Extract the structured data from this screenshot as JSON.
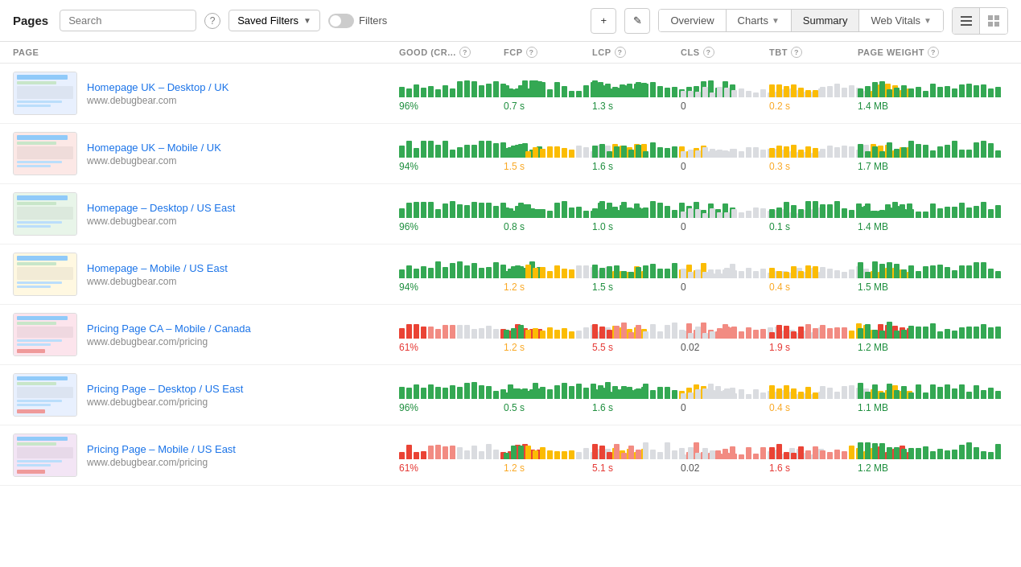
{
  "header": {
    "title": "Pages",
    "search_placeholder": "Search",
    "saved_filters_label": "Saved Filters",
    "filters_label": "Filters",
    "add_icon": "+",
    "edit_icon": "✎",
    "overview_label": "Overview",
    "charts_label": "Charts",
    "summary_label": "Summary",
    "web_vitals_label": "Web Vitals",
    "help_icon": "?"
  },
  "columns": [
    {
      "id": "page",
      "label": "PAGE",
      "has_help": false
    },
    {
      "id": "good_cr",
      "label": "GOOD (CR...",
      "has_help": true
    },
    {
      "id": "fcp",
      "label": "FCP",
      "has_help": true
    },
    {
      "id": "lcp",
      "label": "LCP",
      "has_help": true
    },
    {
      "id": "cls",
      "label": "CLS",
      "has_help": true
    },
    {
      "id": "tbt",
      "label": "TBT",
      "has_help": true
    },
    {
      "id": "page_weight",
      "label": "PAGE WEIGHT",
      "has_help": true
    }
  ],
  "rows": [
    {
      "name": "Homepage UK – Desktop / UK",
      "url": "www.debugbear.com",
      "good_cr": "96%",
      "good_cr_status": "good",
      "fcp": "0.7 s",
      "fcp_status": "good",
      "lcp": "1.3 s",
      "lcp_status": "good",
      "cls": "0",
      "cls_status": "neutral",
      "tbt": "0.2 s",
      "tbt_status": "needs-improvement",
      "page_weight": "1.4 MB",
      "page_weight_status": "good",
      "bars_good_cr": [
        6,
        8,
        7,
        8,
        9,
        7,
        8,
        9,
        8,
        7,
        9,
        10,
        8,
        9,
        10,
        9,
        8,
        9,
        8,
        10
      ],
      "bars_fcp": [
        6,
        7,
        9,
        8,
        7,
        8,
        9,
        8,
        9,
        10,
        8,
        7,
        9,
        8,
        9,
        10,
        9,
        8,
        9,
        10
      ],
      "bars_lcp": [
        6,
        8,
        7,
        9,
        8,
        9,
        8,
        7,
        9,
        10,
        8,
        9,
        8,
        9,
        10,
        9,
        8,
        9,
        8,
        10
      ],
      "bars_cls": [
        6,
        7,
        8,
        9,
        8,
        9,
        8,
        7,
        9,
        10,
        8,
        9,
        10,
        9,
        8,
        9,
        10,
        9,
        8,
        10
      ],
      "bars_tbt": [
        6,
        8,
        7,
        9,
        8,
        9,
        8,
        7,
        9,
        5,
        8,
        4,
        8,
        9,
        10,
        9,
        8,
        9,
        8,
        10
      ],
      "bars_pw": [
        6,
        8,
        7,
        9,
        8,
        9,
        8,
        7,
        9,
        10,
        8,
        9,
        10,
        9,
        8,
        9,
        10,
        9,
        8,
        10
      ]
    },
    {
      "name": "Homepage UK – Mobile / UK",
      "url": "www.debugbear.com",
      "good_cr": "94%",
      "good_cr_status": "good",
      "fcp": "1.5 s",
      "fcp_status": "needs-improvement",
      "lcp": "1.6 s",
      "lcp_status": "good",
      "cls": "0",
      "cls_status": "neutral",
      "tbt": "0.3 s",
      "tbt_status": "needs-improvement",
      "page_weight": "1.7 MB",
      "page_weight_status": "good"
    },
    {
      "name": "Homepage – Desktop / US East",
      "url": "www.debugbear.com",
      "good_cr": "96%",
      "good_cr_status": "good",
      "fcp": "0.8 s",
      "fcp_status": "good",
      "lcp": "1.0 s",
      "lcp_status": "good",
      "cls": "0",
      "cls_status": "neutral",
      "tbt": "0.1 s",
      "tbt_status": "good",
      "page_weight": "1.4 MB",
      "page_weight_status": "good"
    },
    {
      "name": "Homepage – Mobile / US East",
      "url": "www.debugbear.com",
      "good_cr": "94%",
      "good_cr_status": "good",
      "fcp": "1.2 s",
      "fcp_status": "needs-improvement",
      "lcp": "1.5 s",
      "lcp_status": "good",
      "cls": "0",
      "cls_status": "neutral",
      "tbt": "0.4 s",
      "tbt_status": "needs-improvement",
      "page_weight": "1.5 MB",
      "page_weight_status": "good"
    },
    {
      "name": "Pricing Page CA – Mobile / Canada",
      "url": "www.debugbear.com/pricing",
      "good_cr": "61%",
      "good_cr_status": "poor",
      "fcp": "1.2 s",
      "fcp_status": "needs-improvement",
      "lcp": "5.5 s",
      "lcp_status": "poor",
      "cls": "0.02",
      "cls_status": "neutral",
      "tbt": "1.9 s",
      "tbt_status": "poor",
      "page_weight": "1.2 MB",
      "page_weight_status": "good"
    },
    {
      "name": "Pricing Page – Desktop / US East",
      "url": "www.debugbear.com/pricing",
      "good_cr": "96%",
      "good_cr_status": "good",
      "fcp": "0.5 s",
      "fcp_status": "good",
      "lcp": "1.6 s",
      "lcp_status": "good",
      "cls": "0",
      "cls_status": "neutral",
      "tbt": "0.4 s",
      "tbt_status": "needs-improvement",
      "page_weight": "1.1 MB",
      "page_weight_status": "good"
    },
    {
      "name": "Pricing Page – Mobile / US East",
      "url": "www.debugbear.com/pricing",
      "good_cr": "61%",
      "good_cr_status": "poor",
      "fcp": "1.2 s",
      "fcp_status": "needs-improvement",
      "lcp": "5.1 s",
      "lcp_status": "poor",
      "cls": "0.02",
      "cls_status": "neutral",
      "tbt": "1.6 s",
      "tbt_status": "poor",
      "page_weight": "1.2 MB",
      "page_weight_status": "good"
    }
  ]
}
